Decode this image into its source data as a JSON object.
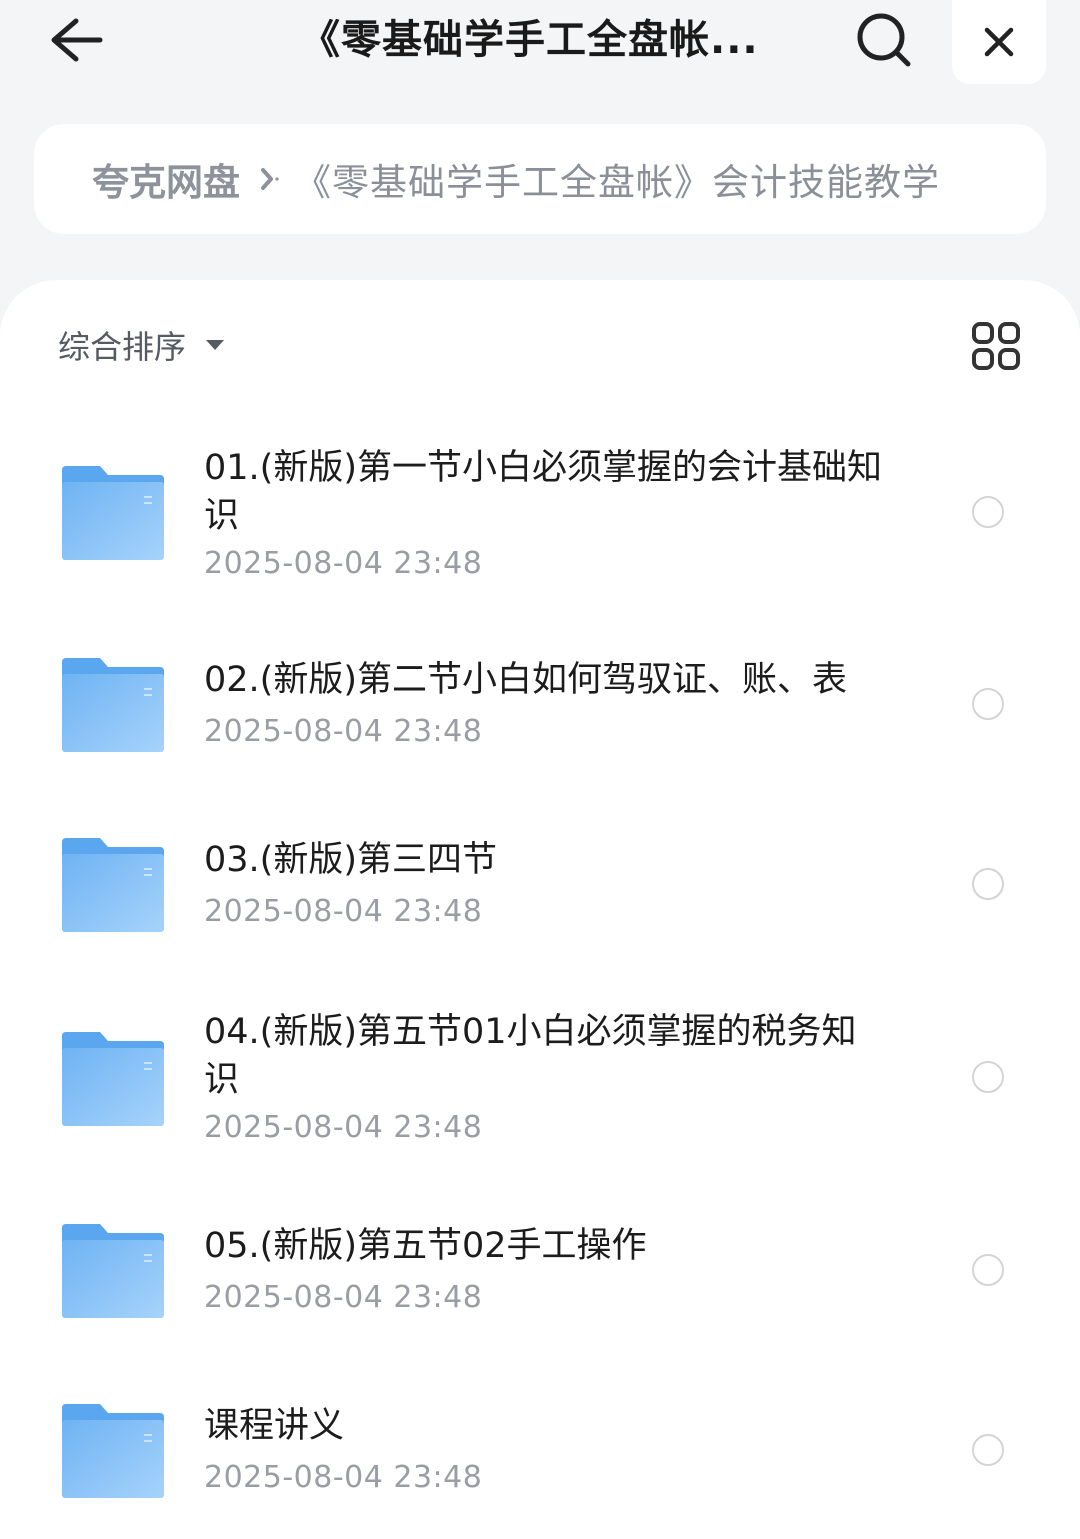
{
  "header": {
    "title": "《零基础学手工全盘帐...",
    "back_icon": "arrow-left-icon",
    "search_icon": "search-icon",
    "close_icon": "close-icon"
  },
  "breadcrumb": {
    "root": "夸克网盘",
    "current": "《零基础学手工全盘帐》会计技能教学"
  },
  "toolbar": {
    "sort_label": "综合排序",
    "view_icon": "grid-view-icon"
  },
  "colors": {
    "folder": "#7fbef6",
    "folder_tab": "#5aa7f0",
    "date_text": "#9a9da3"
  },
  "files": [
    {
      "name": "01.(新版)第一节小白必须掌握的会计基础知识",
      "date": "2025-08-04 23:48"
    },
    {
      "name": "02.(新版)第二节小白如何驾驭证、账、表",
      "date": "2025-08-04 23:48"
    },
    {
      "name": "03.(新版)第三四节",
      "date": "2025-08-04 23:48"
    },
    {
      "name": "04.(新版)第五节01小白必须掌握的税务知识",
      "date": "2025-08-04 23:48"
    },
    {
      "name": "05.(新版)第五节02手工操作",
      "date": "2025-08-04 23:48"
    },
    {
      "name": "课程讲义",
      "date": "2025-08-04 23:48"
    }
  ]
}
